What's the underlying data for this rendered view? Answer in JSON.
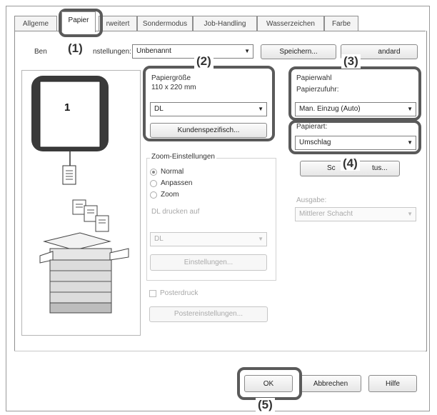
{
  "tabs": [
    {
      "label": "Allgeme"
    },
    {
      "label": "Papier"
    },
    {
      "label": "rweitert"
    },
    {
      "label": "Sondermodus"
    },
    {
      "label": "Job-Handling"
    },
    {
      "label": "Wasserzeichen"
    },
    {
      "label": "Farbe"
    }
  ],
  "settings": {
    "label_left": "Ben",
    "label_right": "nstellungen:",
    "value": "Unbenannt",
    "save_button": "Speichern...",
    "standard_button": "andard"
  },
  "preview": {
    "page_number": "1"
  },
  "paper_size": {
    "label": "Papiergröße",
    "dimensions": "110 x 220 mm",
    "value": "DL",
    "custom_button": "Kundenspezifisch..."
  },
  "zoom": {
    "group_label": "Zoom-Einstellungen",
    "options": [
      "Normal",
      "Anpassen",
      "Zoom"
    ],
    "print_on_label": "DL drucken auf",
    "print_on_value": "DL",
    "settings_button": "Einstellungen..."
  },
  "poster": {
    "checkbox_label": "Posterdruck",
    "settings_button": "Postereinstellungen..."
  },
  "paper_selection": {
    "heading": "Papierwahl",
    "feed_label": "Papierzufuhr:",
    "feed_value": "Man. Einzug (Auto)",
    "type_label": "Papierart:",
    "type_value": "Umschlag",
    "status_button_left": "Sc",
    "status_button_right": "tus..."
  },
  "output": {
    "label": "Ausgabe:",
    "value": "Mittlerer Schacht"
  },
  "footer": {
    "ok": "OK",
    "cancel": "Abbrechen",
    "help": "Hilfe"
  },
  "callouts": [
    "(1)",
    "(2)",
    "(3)",
    "(4)",
    "(5)"
  ],
  "icons": {
    "dropdown": "chevron-down-icon",
    "document": "document-icon",
    "printer": "printer-icon",
    "paper": "paper-stack-icon"
  }
}
